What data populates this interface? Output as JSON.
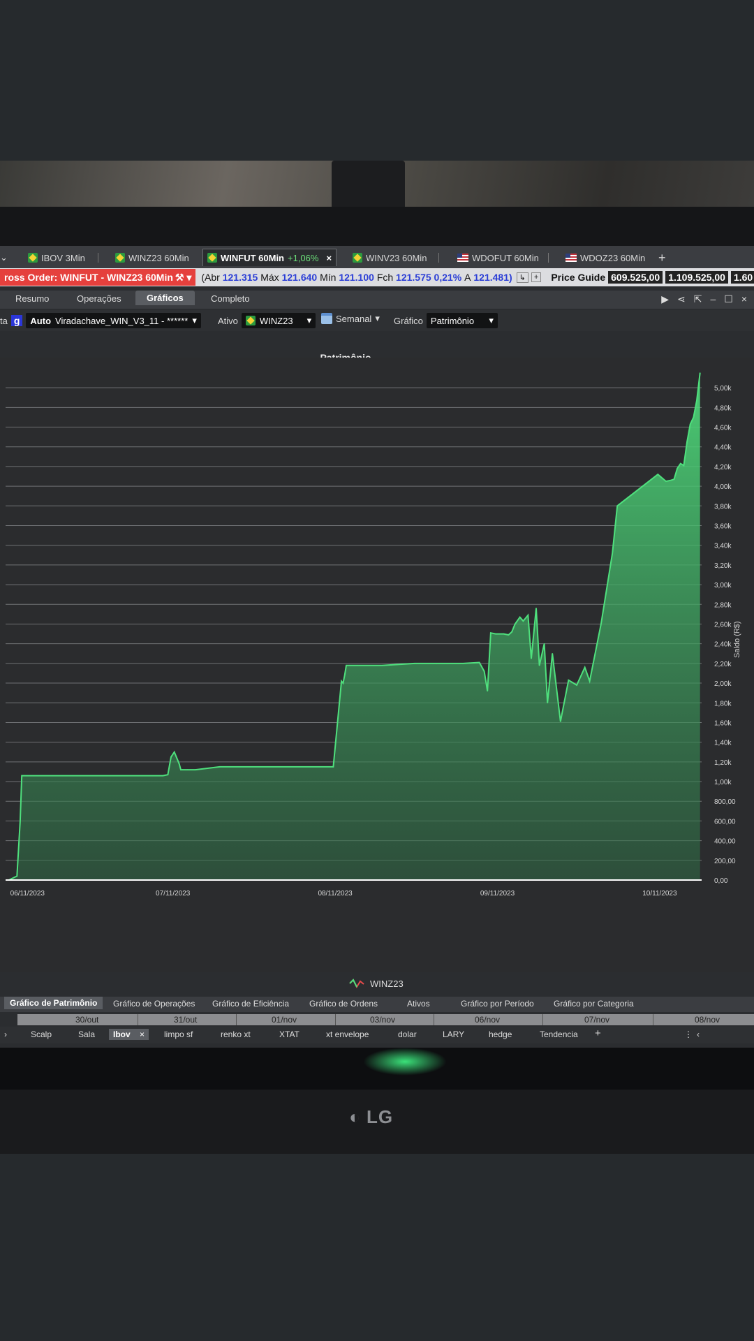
{
  "tabs": [
    {
      "label": "IBOV 3Min",
      "flag": "br"
    },
    {
      "label": "WINZ23 60Min",
      "flag": "br"
    },
    {
      "label": "WINFUT 60Min",
      "flag": "br",
      "change": "+1,06%",
      "close": "×"
    },
    {
      "label": "WINV23 60Min",
      "flag": "br"
    },
    {
      "label": "WDOFUT 60Min",
      "flag": "us"
    },
    {
      "label": "WDOZ23 60Min",
      "flag": "us"
    }
  ],
  "tab_add": "+",
  "order_bar": {
    "cross_order": "ross Order: WINFUT - WINZ23 60Min",
    "abr_label": "(Abr",
    "abr": "121.315",
    "max_label": "Máx",
    "max": "121.640",
    "min_label": "Mín",
    "min": "121.100",
    "fch_label": "Fch",
    "fch": "121.575",
    "pct": "0,21%",
    "a_label": "A",
    "a": "121.481)",
    "price_guide_label": "Price Guide",
    "pg1": "609.525,00",
    "pg2": "1.109.525,00",
    "pg3": "1.60"
  },
  "subtabs": [
    "Resumo",
    "Operações",
    "Gráficos",
    "Completo"
  ],
  "toolbar": {
    "left_cut": "ta",
    "g": "g",
    "auto": "Auto",
    "strategy": "Viradachave_WIN_V3_11 - ******",
    "ativo_label": "Ativo",
    "ativo": "WINZ23",
    "period": "Semanal",
    "grafico_label": "Gráfico",
    "grafico": "Patrimônio"
  },
  "chart_data": {
    "type": "area",
    "title": "Patrimônio",
    "ylabel": "Saldo (R$)",
    "ylim": [
      0,
      5150
    ],
    "ytick_labels": [
      "0,00",
      "200,00",
      "400,00",
      "600,00",
      "800,00",
      "1,00k",
      "1,20k",
      "1,40k",
      "1,60k",
      "1,80k",
      "2,00k",
      "2,20k",
      "2,40k",
      "2,60k",
      "2,80k",
      "3,00k",
      "3,20k",
      "3,40k",
      "3,60k",
      "3,80k",
      "4,00k",
      "4,20k",
      "4,40k",
      "4,60k",
      "4,80k",
      "5,00k"
    ],
    "ytick_values": [
      0,
      200,
      400,
      600,
      800,
      1000,
      1200,
      1400,
      1600,
      1800,
      2000,
      2200,
      2400,
      2600,
      2800,
      3000,
      3200,
      3400,
      3600,
      3800,
      4000,
      4200,
      4400,
      4600,
      4800,
      5000
    ],
    "xtick_labels": [
      "06/11/2023",
      "07/11/2023",
      "08/11/2023",
      "09/11/2023",
      "10/11/2023"
    ],
    "xtick_values": [
      0.0,
      1.0,
      2.0,
      3.0,
      4.0
    ],
    "series": [
      {
        "name": "WINZ23",
        "color": "#4fe07d",
        "x": [
          0.0,
          0.05,
          0.07,
          0.08,
          0.1,
          0.95,
          0.98,
          1.0,
          1.02,
          1.05,
          1.06,
          1.07,
          1.08,
          1.1,
          1.15,
          1.3,
          2.0,
          2.05,
          2.06,
          2.07,
          2.08,
          2.1,
          2.15,
          2.3,
          2.5,
          2.8,
          2.9,
          2.93,
          2.95,
          2.97,
          3.0,
          3.05,
          3.08,
          3.1,
          3.12,
          3.15,
          3.17,
          3.2,
          3.22,
          3.25,
          3.27,
          3.3,
          3.32,
          3.35,
          3.4,
          3.45,
          3.5,
          3.55,
          3.58,
          3.65,
          3.72,
          3.75,
          4.0,
          4.05,
          4.08,
          4.1,
          4.12,
          4.14,
          4.16,
          4.18,
          4.2,
          4.22,
          4.24,
          4.26
        ],
        "y": [
          0,
          40,
          600,
          1060,
          1060,
          1060,
          1070,
          1250,
          1300,
          1180,
          1120,
          1120,
          1120,
          1120,
          1120,
          1150,
          1150,
          2020,
          2000,
          2080,
          2180,
          2180,
          2180,
          2180,
          2200,
          2200,
          2210,
          2120,
          1920,
          2510,
          2500,
          2500,
          2490,
          2520,
          2600,
          2670,
          2630,
          2690,
          2250,
          2760,
          2180,
          2400,
          1800,
          2300,
          1610,
          2030,
          1980,
          2160,
          2020,
          2600,
          3320,
          3800,
          4120,
          4050,
          4060,
          4070,
          4180,
          4230,
          4210,
          4450,
          4630,
          4700,
          4870,
          5150
        ]
      }
    ],
    "grid": true,
    "legend": "bottom-center"
  },
  "bottom_tabs": [
    "Gráfico de Patrimônio",
    "Gráfico de Operações",
    "Gráfico de Eficiência",
    "Gráfico de Ordens",
    "Ativos",
    "Gráfico por Período",
    "Gráfico por Categoria"
  ],
  "timeline": [
    "30/out",
    "31/out",
    "01/nov",
    "03/nov",
    "06/nov",
    "07/nov",
    "08/nov"
  ],
  "workspaces": [
    "Scalp",
    "Sala",
    "Ibov",
    "limpo sf",
    "renko xt",
    "XTAT",
    "xt envelope",
    "dolar",
    "LARY",
    "hedge",
    "Tendencia"
  ],
  "ws_close": "×",
  "ws_add": "+",
  "brand": "LG"
}
